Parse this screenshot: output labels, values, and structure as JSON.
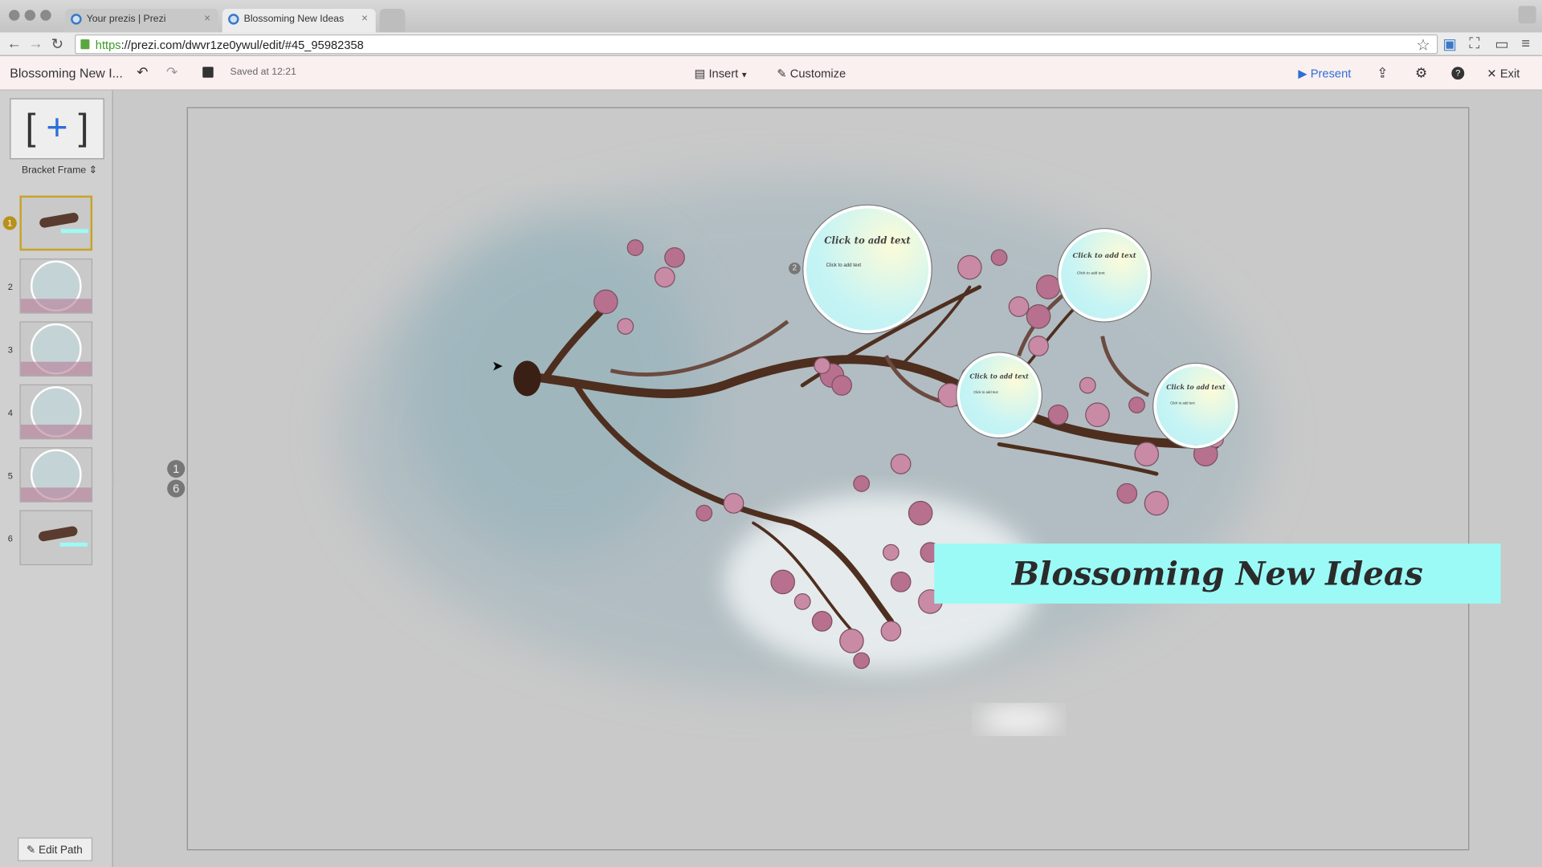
{
  "browser": {
    "tabs": [
      {
        "label": "Your prezis | Prezi",
        "active": false
      },
      {
        "label": "Blossoming New Ideas",
        "active": true
      }
    ],
    "url_scheme": "https",
    "url_rest": "://prezi.com/dwvr1ze0ywul/edit/#45_95982358"
  },
  "toolbar": {
    "title": "Blossoming New I...",
    "saved": "Saved at 12:21",
    "insert": "Insert",
    "customize": "Customize",
    "present": "Present",
    "exit": "Exit",
    "accent": "#2d6fd6"
  },
  "sidebar": {
    "frame_label": "Bracket Frame",
    "frame_icon": "[ + ]",
    "slides": [
      "1",
      "2",
      "3",
      "4",
      "5",
      "6"
    ],
    "active_slide": "1",
    "edit_path": "Edit Path"
  },
  "canvas": {
    "title": "Blossoming New Ideas",
    "title_bg": "#9bfaf6",
    "circles": [
      {
        "num": "2",
        "heading": "Click to add text",
        "body": "Click to add text"
      },
      {
        "heading": "Click to add text",
        "body": "Click to add text"
      },
      {
        "heading": "Click to add text",
        "body": "Click to add text"
      },
      {
        "heading": "Click to add text",
        "body": "Click to add text"
      }
    ],
    "path_markers": [
      "1",
      "6"
    ]
  }
}
